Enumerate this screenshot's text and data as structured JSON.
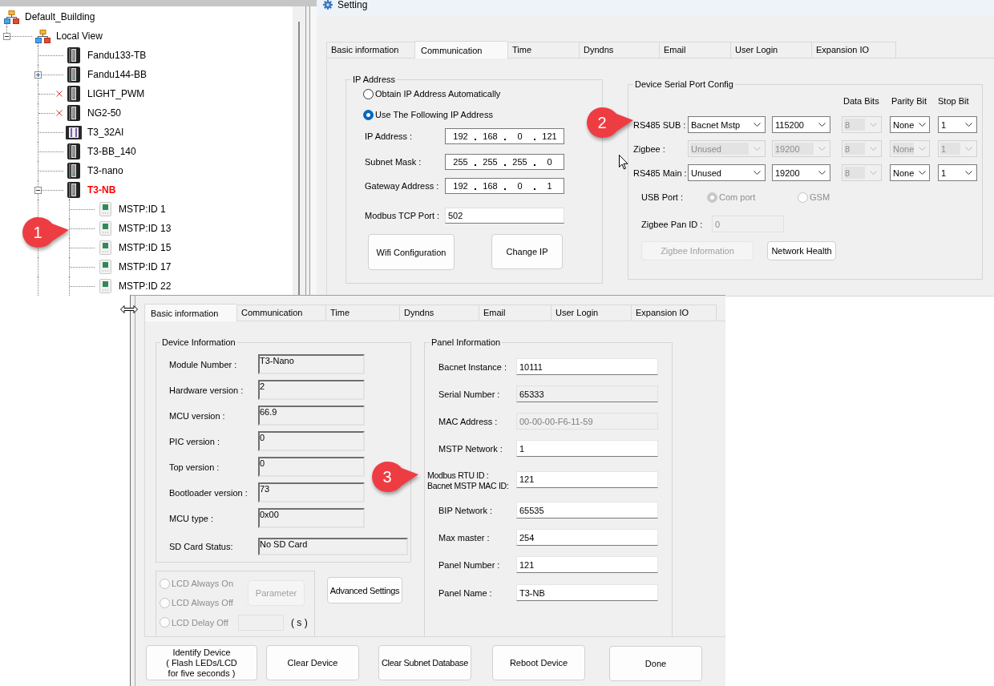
{
  "tree_panel": {
    "nodes": [
      {
        "label": "Default_Building",
        "kind": "network",
        "offline": false,
        "selected": false,
        "children": [
          {
            "label": "Local View",
            "kind": "network",
            "expanded": true,
            "offline": false,
            "selected": false,
            "children": [
              {
                "label": "Fandu133-TB",
                "kind": "controller",
                "offline": false,
                "selected": false
              },
              {
                "label": "Fandu144-BB",
                "kind": "controller",
                "expanded": false,
                "offline": false,
                "selected": false
              },
              {
                "label": "LIGHT_PWM",
                "kind": "controller",
                "offline": true,
                "selected": false
              },
              {
                "label": "NG2-50",
                "kind": "controller",
                "offline": true,
                "selected": false
              },
              {
                "label": "T3_32AI",
                "kind": "io-module",
                "offline": false,
                "selected": false
              },
              {
                "label": "T3-BB_140",
                "kind": "controller",
                "offline": false,
                "selected": false
              },
              {
                "label": "T3-nano",
                "kind": "controller",
                "offline": false,
                "selected": false
              },
              {
                "label": "T3-NB",
                "kind": "controller",
                "expanded": true,
                "offline": false,
                "selected": true,
                "children": [
                  {
                    "label": "MSTP:ID 1",
                    "kind": "sensor",
                    "offline": false,
                    "selected": false
                  },
                  {
                    "label": "MSTP:ID 13",
                    "kind": "sensor",
                    "offline": false,
                    "selected": false
                  },
                  {
                    "label": "MSTP:ID 15",
                    "kind": "sensor",
                    "offline": false,
                    "selected": false
                  },
                  {
                    "label": "MSTP:ID 17",
                    "kind": "sensor",
                    "offline": false,
                    "selected": false
                  },
                  {
                    "label": "MSTP:ID 22",
                    "kind": "sensor",
                    "offline": false,
                    "selected": false
                  }
                ]
              }
            ]
          }
        ]
      }
    ]
  },
  "setting_window": {
    "title": "Setting",
    "tabs": [
      {
        "label": "Basic information",
        "selected": false
      },
      {
        "label": "Communication",
        "selected": true
      },
      {
        "label": "Time",
        "selected": false
      },
      {
        "label": "Dyndns",
        "selected": false
      },
      {
        "label": "Email",
        "selected": false
      },
      {
        "label": "User Login",
        "selected": false
      },
      {
        "label": "Expansion IO",
        "selected": false
      }
    ],
    "ip_address": {
      "title": "IP Address",
      "options": [
        {
          "label": "Obtain IP Address Automatically",
          "selected": false
        },
        {
          "label": "Use The Following IP Address",
          "selected": true
        }
      ],
      "fields": [
        {
          "label": "IP Address :",
          "octets": [
            "192",
            "168",
            "0",
            "121"
          ]
        },
        {
          "label": "Subnet Mask :",
          "octets": [
            "255",
            "255",
            "255",
            "0"
          ]
        },
        {
          "label": "Gateway Address :",
          "octets": [
            "192",
            "168",
            "0",
            "1"
          ]
        }
      ],
      "tcp_port": {
        "label": "Modbus TCP Port :",
        "value": "502"
      },
      "buttons": [
        "Wifi Configuration",
        "Change IP"
      ]
    },
    "serial_config": {
      "title": "Device Serial Port Config",
      "column_headers": [
        "Data Bits",
        "Parity Bit",
        "Stop Bit"
      ],
      "rows": [
        {
          "label": "RS485 SUB :",
          "combos": [
            {
              "value": "Bacnet Mstp",
              "disabled": false
            },
            {
              "value": "115200",
              "disabled": false
            },
            {
              "value": "8",
              "disabled": true
            },
            {
              "value": "None",
              "disabled": false
            },
            {
              "value": "1",
              "disabled": false
            }
          ]
        },
        {
          "label": "Zigbee :",
          "combos": [
            {
              "value": "Unused",
              "disabled": true
            },
            {
              "value": "19200",
              "disabled": true
            },
            {
              "value": "8",
              "disabled": true
            },
            {
              "value": "None",
              "disabled": true
            },
            {
              "value": "1",
              "disabled": true
            }
          ]
        },
        {
          "label": "RS485 Main :",
          "combos": [
            {
              "value": "Unused",
              "disabled": false
            },
            {
              "value": "19200",
              "disabled": false
            },
            {
              "value": "8",
              "disabled": true
            },
            {
              "value": "None",
              "disabled": false
            },
            {
              "value": "1",
              "disabled": false
            }
          ]
        }
      ],
      "usb_port": {
        "label": "USB Port :",
        "options": [
          {
            "label": "Com port",
            "selected": true,
            "disabled": true
          },
          {
            "label": "GSM",
            "selected": false,
            "disabled": true
          }
        ]
      },
      "pan_id": {
        "label": "Zigbee Pan ID :",
        "value": "0",
        "disabled": true
      },
      "buttons": [
        {
          "label": "Zigbee Information",
          "disabled": true
        },
        {
          "label": "Network Health",
          "disabled": false
        }
      ]
    }
  },
  "basic_window": {
    "tabs": [
      {
        "label": "Basic information",
        "selected": true
      },
      {
        "label": "Communication",
        "selected": false
      },
      {
        "label": "Time",
        "selected": false
      },
      {
        "label": "Dyndns",
        "selected": false
      },
      {
        "label": "Email",
        "selected": false
      },
      {
        "label": "User Login",
        "selected": false
      },
      {
        "label": "Expansion IO",
        "selected": false
      }
    ],
    "device_info": {
      "title": "Device Information",
      "fields": [
        {
          "label": "Module Number :",
          "value": "T3-Nano"
        },
        {
          "label": "Hardware version :",
          "value": "2"
        },
        {
          "label": "MCU version :",
          "value": "66.9"
        },
        {
          "label": "PIC version :",
          "value": "0"
        },
        {
          "label": "Top version :",
          "value": "0"
        },
        {
          "label": "Bootloader version :",
          "value": "73"
        },
        {
          "label": "MCU type :",
          "value": "0x00"
        },
        {
          "label": "SD Card Status:",
          "value": "No SD Card"
        }
      ]
    },
    "lcd": {
      "options": [
        {
          "label": "LCD Always On",
          "selected": false,
          "disabled": true
        },
        {
          "label": "LCD Always Off",
          "selected": false,
          "disabled": true
        },
        {
          "label": "LCD Delay Off",
          "selected": false,
          "disabled": true
        }
      ],
      "parameter_button": {
        "label": "Parameter",
        "disabled": true
      },
      "delay_field": {
        "disabled": true
      },
      "delay_unit": "( s )"
    },
    "advanced_button": "Advanced Settings",
    "panel_info": {
      "title": "Panel Information",
      "fields": [
        {
          "label": "Bacnet Instance :",
          "value": "10111",
          "readonly": false,
          "disabled": false
        },
        {
          "label": "Serial Number :",
          "value": "65333",
          "readonly": true,
          "disabled": false
        },
        {
          "label": "MAC Address :",
          "value": "00-00-00-F6-11-59",
          "readonly": false,
          "disabled": true
        },
        {
          "label": "MSTP Network :",
          "value": "1",
          "readonly": false,
          "disabled": false
        },
        {
          "label_lines": [
            "Modbus RTU ID :",
            "Bacnet MSTP MAC ID:"
          ],
          "value": "121",
          "readonly": false,
          "disabled": false
        },
        {
          "label": "BIP Network :",
          "value": "65535",
          "readonly": false,
          "disabled": false
        },
        {
          "label": "Max master :",
          "value": "254",
          "readonly": false,
          "disabled": false
        },
        {
          "label": "Panel Number :",
          "value": "121",
          "readonly": false,
          "disabled": false
        },
        {
          "label": "Panel Name :",
          "value": "T3-NB",
          "readonly": false,
          "disabled": false
        }
      ]
    },
    "actions": [
      "Identify Device\n( Flash LEDs/LCD\nfor five seconds )",
      "Clear Device",
      "Clear Subnet Database",
      "Reboot Device",
      "Done"
    ]
  },
  "callouts": [
    "1",
    "2",
    "3"
  ]
}
